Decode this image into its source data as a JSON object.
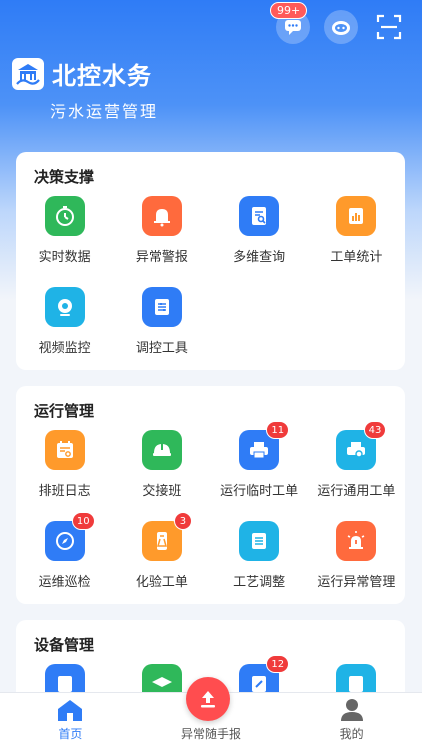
{
  "header": {
    "brand": "北控水务",
    "subtitle": "污水运营管理",
    "message_badge": "99+"
  },
  "sections": [
    {
      "title": "决策支撑",
      "items": [
        {
          "label": "实时数据",
          "icon": "stopwatch-icon",
          "color": "#2fb85a"
        },
        {
          "label": "异常警报",
          "icon": "bell-icon",
          "color": "#ff6a3d"
        },
        {
          "label": "多维查询",
          "icon": "document-search-icon",
          "color": "#2f7cf6"
        },
        {
          "label": "工单统计",
          "icon": "bar-chart-icon",
          "color": "#ff9a2b"
        },
        {
          "label": "视频监控",
          "icon": "camera-icon",
          "color": "#1fb3e6"
        },
        {
          "label": "调控工具",
          "icon": "toolbox-icon",
          "color": "#2f7cf6"
        }
      ]
    },
    {
      "title": "运行管理",
      "items": [
        {
          "label": "排班日志",
          "icon": "calendar-icon",
          "color": "#ff9a2b"
        },
        {
          "label": "交接班",
          "icon": "helmet-icon",
          "color": "#2fb85a"
        },
        {
          "label": "运行临时工单",
          "icon": "printer-icon",
          "color": "#2f7cf6",
          "badge": "11"
        },
        {
          "label": "运行通用工单",
          "icon": "printer-gear-icon",
          "color": "#1fb3e6",
          "badge": "43"
        },
        {
          "label": "运维巡检",
          "icon": "compass-icon",
          "color": "#2f7cf6",
          "badge": "10"
        },
        {
          "label": "化验工单",
          "icon": "flask-icon",
          "color": "#ff9a2b",
          "badge": "3"
        },
        {
          "label": "工艺调整",
          "icon": "adjust-list-icon",
          "color": "#1fb3e6"
        },
        {
          "label": "运行异常管理",
          "icon": "alarm-light-icon",
          "color": "#ff6a3d"
        }
      ]
    },
    {
      "title": "设备管理",
      "items": [
        {
          "label": "",
          "icon": "device-icon",
          "color": "#2f7cf6"
        },
        {
          "label": "",
          "icon": "graduation-icon",
          "color": "#2fb85a"
        },
        {
          "label": "",
          "icon": "wrench-icon",
          "color": "#2f7cf6",
          "badge": "12"
        },
        {
          "label": "",
          "icon": "clipboard-icon",
          "color": "#1fb3e6"
        }
      ]
    }
  ],
  "tabbar": {
    "home": "首页",
    "report": "异常随手报",
    "mine": "我的"
  },
  "colors": {
    "primary": "#2f7cf6",
    "report_button": "#ff4d4f"
  }
}
